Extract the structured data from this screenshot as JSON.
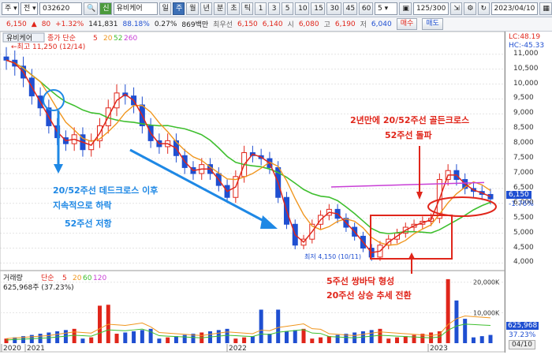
{
  "toolbar": {
    "code_type": "주",
    "market": "전",
    "code": "032620",
    "name_badge": "신",
    "name": "유비케어",
    "period_tabs": [
      "일",
      "주",
      "월",
      "년",
      "분",
      "초",
      "틱"
    ],
    "selected_period": "주",
    "intervals": [
      "1",
      "3",
      "5",
      "10",
      "15",
      "30",
      "45",
      "60"
    ],
    "interval_value": "5",
    "count": "125/300",
    "date": "2023/04/10"
  },
  "quote": {
    "price": "6,150",
    "change": "80",
    "change_pct": "+1.32%",
    "volume": "141,831",
    "vol_ratio": "88.18%",
    "turnover_rate": "0.27%",
    "amount": "869백만",
    "bid_label": "최우선",
    "bid1": "6,150",
    "bid2": "6,140",
    "open_label": "시",
    "open": "6,080",
    "high_label": "고",
    "high": "6,190",
    "low_label": "저",
    "low": "6,040",
    "buy_label": "매수",
    "sell_label": "매도"
  },
  "price_panel": {
    "stock_tab": "유비케어",
    "legend_label": "종가 단순",
    "ma_periods": [
      "5",
      "20",
      "52",
      "260"
    ],
    "max_note": "최고 11,250 (12/14)",
    "min_note": "최저 4,150 (10/11)",
    "lc_label": "LC:48.19",
    "hc_label": "HC:-45.33",
    "current_price_tag": "6,150",
    "change_pct_tag": "-1.76%",
    "y_ticks": [
      "11,000",
      "10,500",
      "10,000",
      "9,500",
      "9,000",
      "8,500",
      "8,000",
      "7,500",
      "7,000",
      "6,500",
      "6,000",
      "5,500",
      "5,000",
      "4,500",
      "4,000"
    ]
  },
  "volume_panel": {
    "label": "거래량",
    "legend_label": "단순",
    "ma_periods": [
      "5",
      "20",
      "60",
      "120"
    ],
    "value_note": "625,968주 (37.23%)",
    "y_ticks": [
      "20,000K",
      "10,000K"
    ],
    "current_tag": "625,968",
    "pct_tag": "37.23%"
  },
  "x_axis": {
    "labels": [
      "2020",
      "2021",
      "2022",
      "2023",
      "04/10"
    ]
  },
  "annotations": {
    "golden_cross_1": "2년만에 20/52주선 골든크로스",
    "golden_cross_2": "52주선 돌파",
    "dead_cross_1": "20/52주선 데드크로스 이후",
    "dead_cross_2": "지속적으로 하락",
    "resist": "52주선 저항",
    "bottom_1": "5주선 쌍바닥 형성",
    "bottom_2": "20주선 상승 추세 전환"
  },
  "colors": {
    "up": "#e0261b",
    "down": "#1f4fd1",
    "ma5": "#e0261b",
    "ma20": "#f0961e",
    "ma52": "#3fbf2f",
    "ma260": "#c83fd6",
    "annotation_blue": "#1e88e5",
    "annotation_red": "#e0261b"
  },
  "chart_data": {
    "type": "line",
    "weekly_close_approx": [
      10800,
      10600,
      10200,
      9600,
      9200,
      8600,
      8200,
      8000,
      8300,
      7800,
      8100,
      8600,
      9200,
      9700,
      9600,
      9300,
      8600,
      8100,
      7900,
      8100,
      7600,
      7200,
      7000,
      7300,
      7000,
      6600,
      6200,
      6900,
      7700,
      7600,
      7500,
      7200,
      6200,
      5300,
      4600,
      4800,
      5300,
      5600,
      5800,
      5500,
      5200,
      4900,
      4500,
      4200,
      4600,
      4800,
      5000,
      5200,
      5300,
      5400,
      5500,
      6800,
      7100,
      6800,
      6500,
      6400,
      6300,
      6150
    ],
    "ylim": [
      3800,
      11600
    ]
  }
}
